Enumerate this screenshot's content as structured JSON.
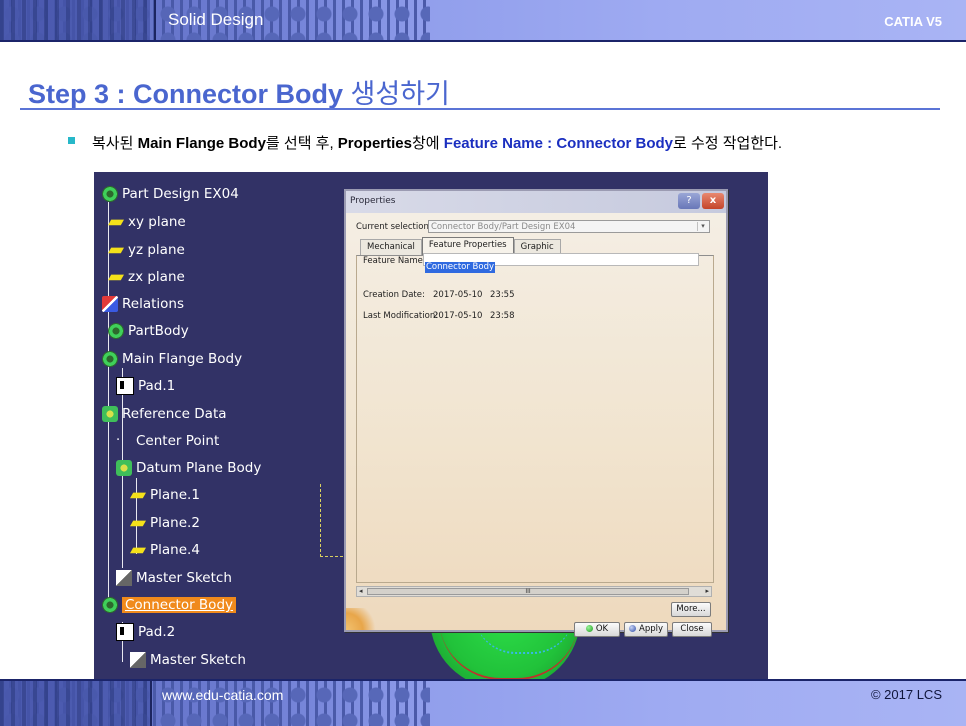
{
  "header": {
    "title": "Solid Design",
    "product": "CATIA V5"
  },
  "slide": {
    "title_en": "Step 3 : Connector Body",
    "title_kr": " 생성하기",
    "bullet_parts": [
      "복사된 ",
      "Main Flange Body",
      "를 선택 후, ",
      "Properties",
      "창에 ",
      "Feature Name : Connector Body",
      "로 수정 작업한다."
    ]
  },
  "tree": {
    "root": "Part Design EX04",
    "items": [
      "xy plane",
      "yz plane",
      "zx plane",
      "Relations",
      "PartBody",
      "Main Flange Body",
      "Pad.1",
      "Reference Data",
      "Center Point",
      "Datum Plane Body",
      "Plane.1",
      "Plane.2",
      "Plane.4",
      "Master Sketch",
      "Connector Body",
      "Pad.2",
      "Master Sketch"
    ]
  },
  "dialog": {
    "title": "Properties",
    "help_btn": "?",
    "close_btn": "x",
    "current_selection_label": "Current selection :",
    "current_selection_value": "Connector Body/Part Design EX04",
    "tabs": [
      "Mechanical",
      "Feature Properties",
      "Graphic"
    ],
    "feature_name_label": "Feature Name :",
    "feature_name_value": "Connector Body",
    "creation_date_label": "Creation Date:",
    "creation_date": "2017-05-10",
    "creation_time": "23:55",
    "last_mod_label": "Last Modification:",
    "last_mod_date": "2017-05-10",
    "last_mod_time": "23:58",
    "scroll_grip": "III",
    "buttons": {
      "more": "More...",
      "ok": "OK",
      "apply": "Apply",
      "close": "Close"
    }
  },
  "footer": {
    "url": "www.edu-catia.com",
    "copyright": "© 2017 LCS"
  }
}
